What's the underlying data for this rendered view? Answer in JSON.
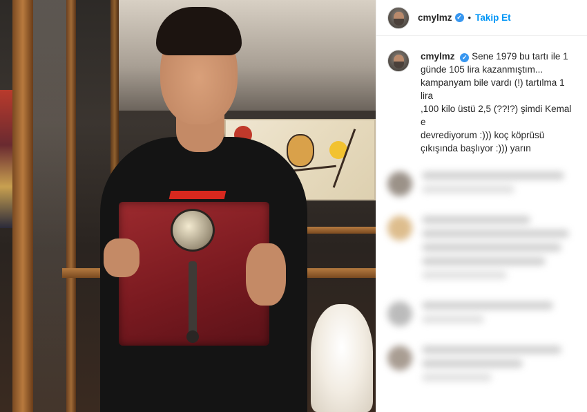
{
  "post": {
    "username": "cmylmz",
    "follow_label": "Takip Et",
    "separator": "•",
    "verified_glyph": "✓",
    "caption_lines": [
      "Sene 1979 bu tartı ile 1",
      "günde 105 lira kazanmıştım...",
      "kampanyam bile vardı (!) tartılma 1 lira",
      ",100 kilo üstü 2,5 (??!?) şimdi Kemal e",
      "devrediyorum :))) koç köprüsü",
      "çıkışında başlıyor :))) yarın"
    ]
  },
  "icons": {
    "verified": "verified-badge-icon",
    "avatar": "profile-avatar"
  },
  "colors": {
    "follow": "#0095f6",
    "verified": "#3897f0",
    "text": "#262626",
    "border": "#efefef"
  }
}
